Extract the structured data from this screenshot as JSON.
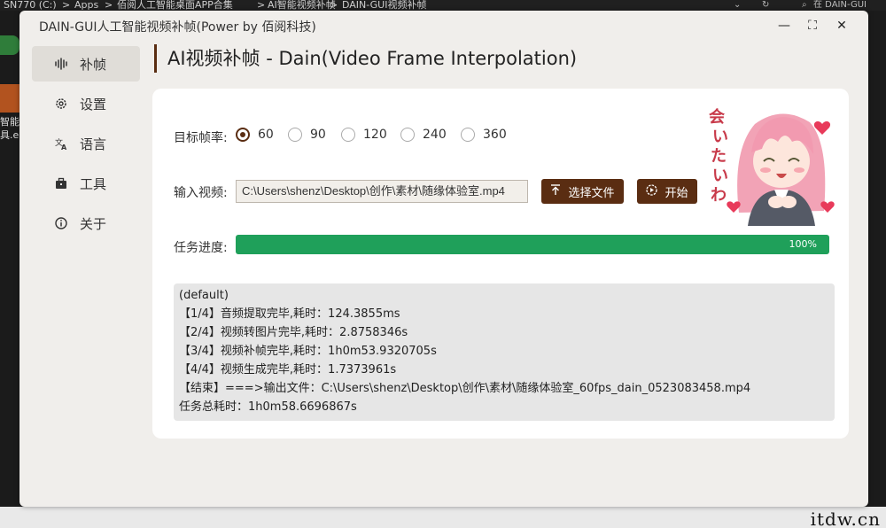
{
  "background": {
    "breadcrumb": [
      "SN770 (C:)",
      ">",
      "Apps",
      ">",
      "佰阅人工智能桌面APP合集",
      ">",
      "AI智能视频补帧",
      ">",
      "DAIN-GUI视频补帧"
    ],
    "search_placeholder": "在 DAIN-GUI",
    "desktop_icon_text": "智能\n具.e",
    "watermark": "itdw.cn"
  },
  "window": {
    "title": "DAIN-GUI人工智能视频补帧(Power by 佰阅科技)",
    "controls": {
      "minimize": "—",
      "maximize": "⛶",
      "close": "✕"
    }
  },
  "sidebar": {
    "items": [
      {
        "label": "补帧",
        "icon": "waveform-icon",
        "active": true
      },
      {
        "label": "设置",
        "icon": "gear-icon",
        "active": false
      },
      {
        "label": "语言",
        "icon": "translate-icon",
        "active": false
      },
      {
        "label": "工具",
        "icon": "toolbox-icon",
        "active": false
      },
      {
        "label": "关于",
        "icon": "info-icon",
        "active": false
      }
    ]
  },
  "main": {
    "title": "AI视频补帧 - Dain(Video Frame Interpolation)",
    "framerate": {
      "label": "目标帧率:",
      "options": [
        "60",
        "90",
        "120",
        "240",
        "360"
      ],
      "selected": "60"
    },
    "input": {
      "label": "输入视频:",
      "value": "C:\\Users\\shenz\\Desktop\\创作\\素材\\随缘体验室.mp4"
    },
    "buttons": {
      "select_file": "选择文件",
      "start": "开始"
    },
    "progress": {
      "label": "任务进度:",
      "value": 100,
      "text": "100%"
    },
    "log": [
      "(default)",
      "【1/4】音频提取完毕,耗时：124.3855ms",
      "【2/4】视频转图片完毕,耗时：2.8758346s",
      "【3/4】视频补帧完毕,耗时：1h0m53.9320705s",
      "【4/4】视频生成完毕,耗时：1.7373961s",
      "【结束】===>输出文件：C:\\Users\\shenz\\Desktop\\创作\\素材\\随缘体验室_60fps_dain_0523083458.mp4",
      "任务总耗时：1h0m58.6696867s"
    ],
    "mascot_text": "会いたいわ"
  },
  "colors": {
    "accent": "#5a2d12",
    "progress": "#1fa05a",
    "window_bg": "#f0eeeb",
    "card_bg": "#ffffff",
    "log_bg": "#e6e6e6"
  }
}
